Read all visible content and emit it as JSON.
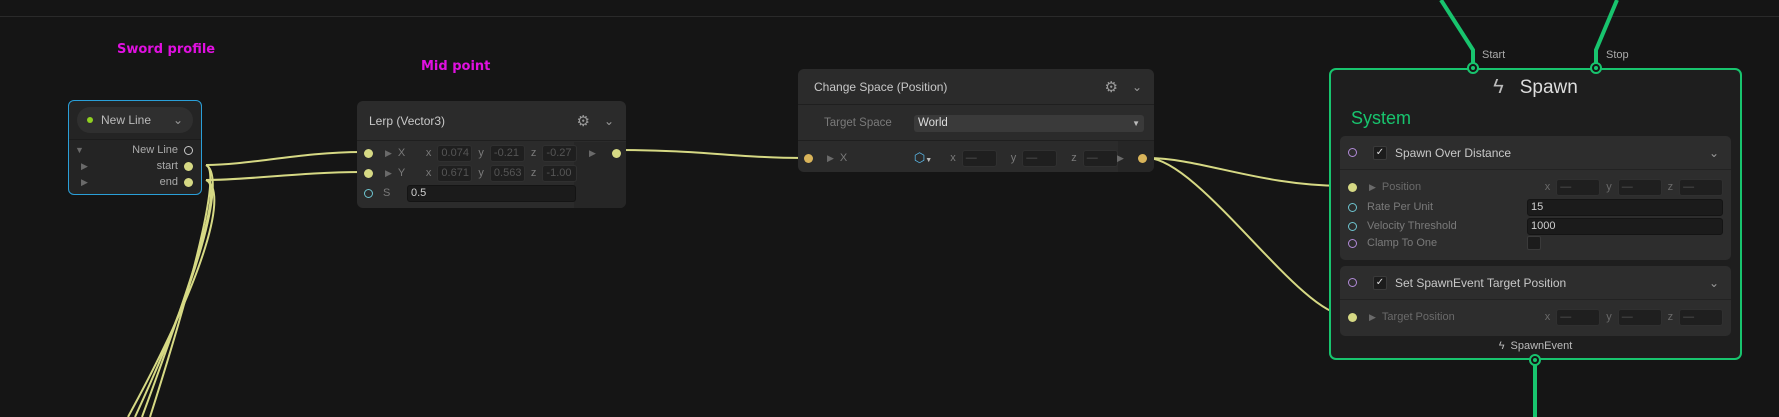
{
  "stickies": {
    "sword": "Sword profile",
    "mid": "Mid point"
  },
  "new_line_node": {
    "title": "New Line",
    "outputs": [
      "New Line",
      "start",
      "end"
    ]
  },
  "lerp_node": {
    "title": "Lerp (Vector3)",
    "x_label": "X",
    "y_label": "Y",
    "s_label": "S",
    "x": {
      "x": "0.074",
      "y": "-0.21",
      "z": "-0.27"
    },
    "y": {
      "x": "0.671",
      "y": "0.563",
      "z": "-1.00"
    },
    "s": "0.5"
  },
  "change_space_node": {
    "title": "Change Space (Position)",
    "target_space_label": "Target Space",
    "target_space_value": "World",
    "x_label": "X",
    "placeholder": "—"
  },
  "spawn_node": {
    "title": "Spawn",
    "context": "System",
    "start": "Start",
    "stop": "Stop",
    "output": "SpawnEvent",
    "block1": {
      "title": "Spawn Over Distance",
      "checked": true,
      "position": "Position",
      "rate_label": "Rate Per Unit",
      "rate": "15",
      "vel_label": "Velocity Threshold",
      "vel": "1000",
      "clamp_label": "Clamp To One"
    },
    "block2": {
      "title": "Set SpawnEvent Target Position",
      "checked": true,
      "target": "Target Position"
    }
  },
  "axes": {
    "x": "x",
    "y": "y",
    "z": "z"
  },
  "colors": {
    "wire": "#d6d984",
    "flow": "#18c46e",
    "sticky": "#e010e0",
    "selection": "#2a9fd8"
  }
}
